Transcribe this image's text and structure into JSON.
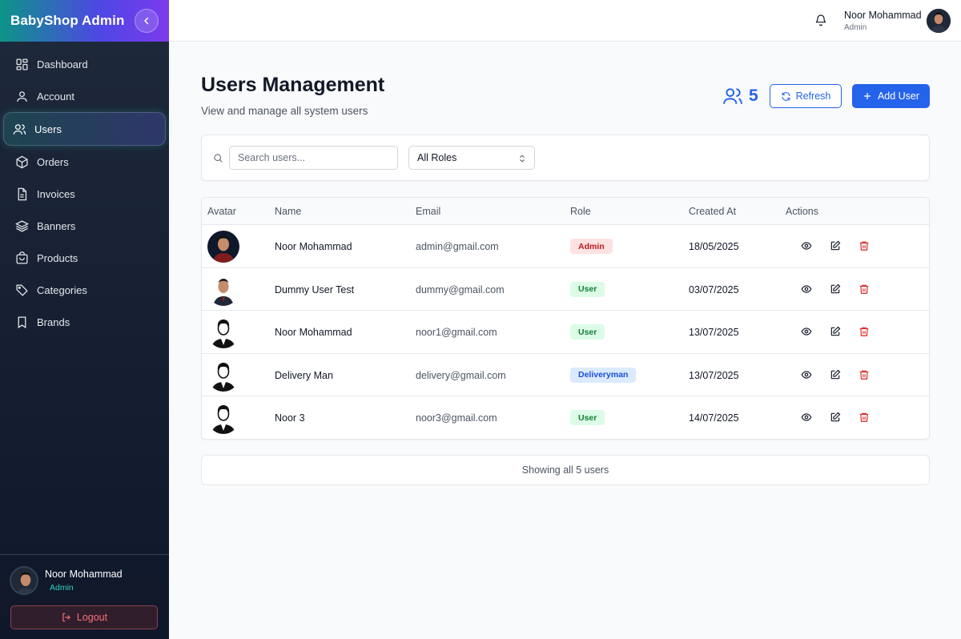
{
  "sidebar": {
    "brand": "BabyShop Admin",
    "items": [
      {
        "label": "Dashboard",
        "icon": "dashboard-icon"
      },
      {
        "label": "Account",
        "icon": "user-icon"
      },
      {
        "label": "Users",
        "icon": "users-icon",
        "active": true
      },
      {
        "label": "Orders",
        "icon": "box-icon"
      },
      {
        "label": "Invoices",
        "icon": "file-icon"
      },
      {
        "label": "Banners",
        "icon": "layers-icon"
      },
      {
        "label": "Products",
        "icon": "bag-icon"
      },
      {
        "label": "Categories",
        "icon": "tag-icon"
      },
      {
        "label": "Brands",
        "icon": "bookmark-icon"
      }
    ],
    "user": {
      "name": "Noor Mohammad",
      "role": "Admin"
    },
    "logout_label": "Logout"
  },
  "topbar": {
    "user_name": "Noor Mohammad",
    "user_role": "Admin"
  },
  "page": {
    "title": "Users Management",
    "subtitle": "View and manage all system users",
    "user_count": "5",
    "refresh_label": "Refresh",
    "add_label": "Add User"
  },
  "filters": {
    "search_placeholder": "Search users...",
    "role_selected": "All Roles"
  },
  "table": {
    "headers": {
      "avatar": "Avatar",
      "name": "Name",
      "email": "Email",
      "role": "Role",
      "created": "Created At",
      "actions": "Actions"
    },
    "rows": [
      {
        "name": "Noor Mohammad",
        "email": "admin@gmail.com",
        "role": "Admin",
        "created": "18/05/2025",
        "avatar": "photo-dark"
      },
      {
        "name": "Dummy User Test",
        "email": "dummy@gmail.com",
        "role": "User",
        "created": "03/07/2025",
        "avatar": "photo-light"
      },
      {
        "name": "Noor Mohammad",
        "email": "noor1@gmail.com",
        "role": "User",
        "created": "13/07/2025",
        "avatar": "silhouette"
      },
      {
        "name": "Delivery Man",
        "email": "delivery@gmail.com",
        "role": "Deliveryman",
        "created": "13/07/2025",
        "avatar": "silhouette"
      },
      {
        "name": "Noor 3",
        "email": "noor3@gmail.com",
        "role": "User",
        "created": "14/07/2025",
        "avatar": "silhouette"
      }
    ]
  },
  "footer": {
    "text": "Showing all 5 users"
  },
  "colors": {
    "accent": "#2563eb",
    "admin_badge_bg": "#fee2e2",
    "admin_badge_fg": "#b91c1c",
    "user_badge_bg": "#dcfce7",
    "user_badge_fg": "#15803d",
    "delivery_badge_bg": "#dbeafe",
    "delivery_badge_fg": "#1d4ed8",
    "delete_icon": "#dc2626"
  }
}
